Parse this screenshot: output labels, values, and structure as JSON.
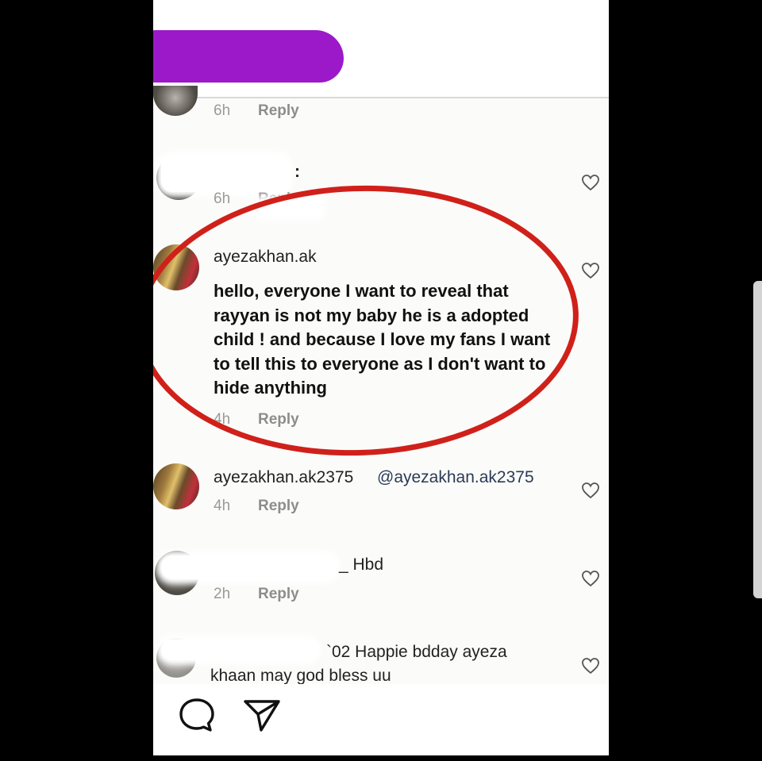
{
  "comments": [
    {
      "time": "6h",
      "reply_label": "Reply"
    },
    {
      "time": "6h",
      "reply_label": "Reply",
      "separator": ":"
    },
    {
      "username": "ayezakhan.ak",
      "text": "hello, everyone I want to reveal that rayyan is not my baby he is a adopted child ! and because I love my fans I want to tell this to everyone as I don't want to hide anything",
      "time": "4h",
      "reply_label": "Reply"
    },
    {
      "username": "ayezakhan.ak2375",
      "mention": "@ayezakhan.ak2375",
      "time": "4h",
      "reply_label": "Reply"
    },
    {
      "text": "_ Hbd",
      "time": "2h",
      "reply_label": "Reply"
    },
    {
      "text_line1": "`02 Happie bdday ayeza",
      "text_line2": "khaan may god bless uu"
    }
  ],
  "icons": {
    "like": "heart-outline-icon",
    "comment": "speech-bubble-icon",
    "share": "paper-plane-icon"
  },
  "colors": {
    "redaction": "#9b19c9",
    "highlight_circle": "#d0201a",
    "background": "#000000"
  }
}
